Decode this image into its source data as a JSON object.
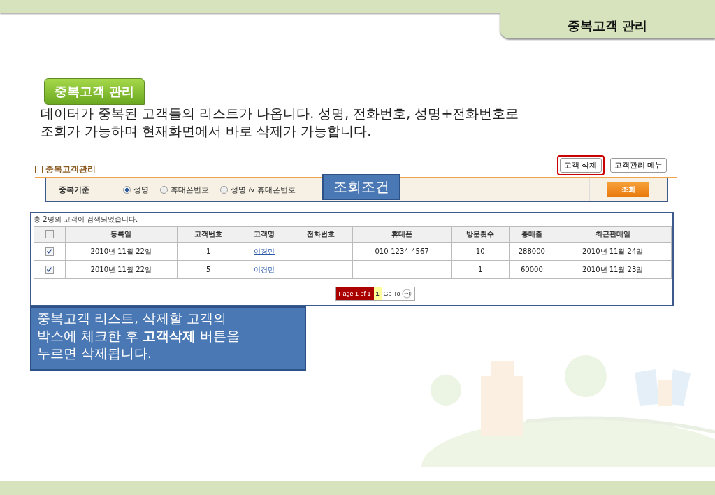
{
  "header": {
    "title": "중복고객 관리"
  },
  "section": {
    "badge": "중복고객 관리",
    "description": "데이터가 중복된 고객들의 리스트가 나옵니다. 성명, 전화번호, 성명+전화번호로\n조회가 가능하며 현재화면에서 바로 삭제가 가능합니다."
  },
  "app": {
    "title": "중복고객관리",
    "buttons": [
      {
        "label": "고객 삭제",
        "highlighted": true
      },
      {
        "label": "고객관리 메뉴",
        "highlighted": false
      }
    ],
    "filter": {
      "label": "중복기준",
      "options": [
        {
          "label": "성명",
          "selected": true
        },
        {
          "label": "휴대폰번호",
          "selected": false
        },
        {
          "label": "성명 & 휴대폰번호",
          "selected": false
        }
      ],
      "search_button": "조회",
      "callout": "조회조건"
    },
    "result_count": "총 2명의 고객이 검색되었습니다.",
    "table": {
      "all_checked": false,
      "columns": [
        "등록일",
        "고객번호",
        "고객명",
        "전화번호",
        "휴대폰",
        "방문횟수",
        "총매출",
        "최근판매일"
      ],
      "rows": [
        {
          "checked": true,
          "cells": [
            "2010년 11월 22일",
            "1",
            "이경민",
            "",
            "010-1234-4567",
            "10",
            "288000",
            "2010년 11월 24일"
          ]
        },
        {
          "checked": true,
          "cells": [
            "2010년 11월 22일",
            "5",
            "이경민",
            "",
            "",
            "1",
            "60000",
            "2010년 11월 23일"
          ]
        }
      ]
    },
    "pagination": {
      "summary": "Page 1 of 1",
      "current": "1",
      "goto": "Go To"
    }
  },
  "callout": "중복고객 리스트, 삭제할 고객의\n박스에 체크한 후 **고객삭제** 버튼을\n누르면 삭제됩니다."
}
